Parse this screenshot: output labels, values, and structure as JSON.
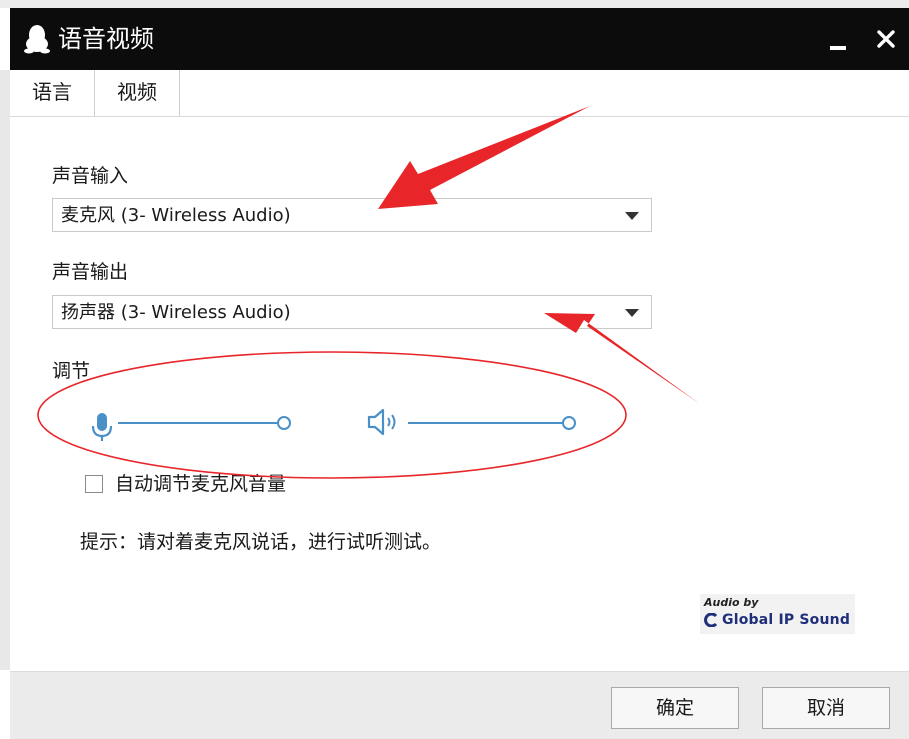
{
  "window": {
    "title": "语音视频"
  },
  "tabs": [
    {
      "label": "语言"
    },
    {
      "label": "视频"
    }
  ],
  "input": {
    "label": "声音输入",
    "device": "麦克风 (3- Wireless Audio)"
  },
  "output": {
    "label": "声音输出",
    "device": "扬声器 (3- Wireless Audio)"
  },
  "adjust": {
    "label": "调节",
    "mic_level": 1.0,
    "speaker_level": 1.0
  },
  "auto_adjust": {
    "label": "自动调节麦克风音量",
    "checked": false
  },
  "hint": "提示：请对着麦克风说话，进行试听测试。",
  "branding": {
    "top": "Audio by",
    "name": "Global IP Sound"
  },
  "buttons": {
    "ok": "确定",
    "cancel": "取消"
  },
  "colors": {
    "accent": "#4a90c8",
    "annotation": "#e8262a",
    "titlebar": "#0c0c0c"
  },
  "icons": {
    "app": "qq-penguin-icon",
    "mic": "microphone-icon",
    "speaker": "speaker-icon"
  }
}
